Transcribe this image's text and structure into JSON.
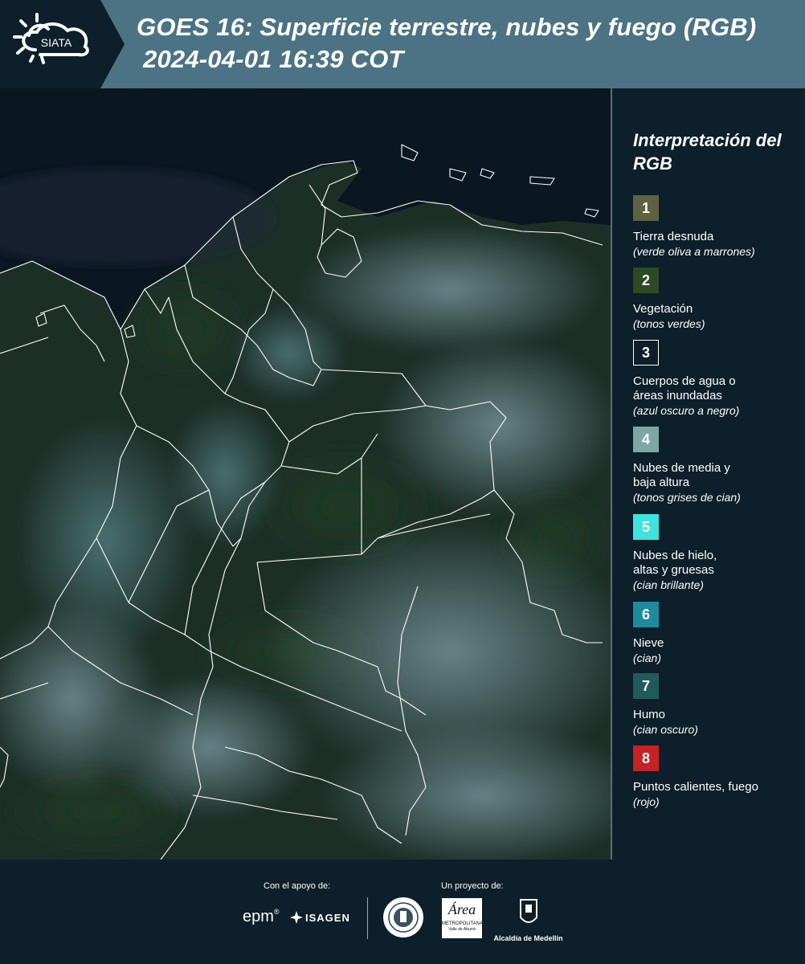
{
  "header": {
    "logo_text": "SIATA",
    "title_line1": "GOES 16: Superficie terrestre, nubes y fuego (RGB)",
    "title_line2": "2024-04-01 16:39 COT"
  },
  "legend": {
    "title": "Interpretación del RGB",
    "items": [
      {
        "number": "1",
        "label": "Tierra desnuda",
        "description": "(verde oliva a marrones)",
        "color": "#5e6142"
      },
      {
        "number": "2",
        "label": "Vegetación",
        "description": "(tonos verdes)",
        "color": "#2d4a22"
      },
      {
        "number": "3",
        "label": "Cuerpos de agua o áreas inundadas",
        "description": "(azul oscuro a negro)",
        "color": "#0c1f2a"
      },
      {
        "number": "4",
        "label": "Nubes de media y baja altura",
        "description": "(tonos grises de cian)",
        "color": "#7fa6a7"
      },
      {
        "number": "5",
        "label": "Nubes de hielo, altas y gruesas",
        "description": "(cian brillante)",
        "color": "#3ee3df"
      },
      {
        "number": "6",
        "label": "Nieve",
        "description": "(cian)",
        "color": "#1f8a9c"
      },
      {
        "number": "7",
        "label": "Humo",
        "description": "(cian oscuro)",
        "color": "#215a5d"
      },
      {
        "number": "8",
        "label": "Puntos calientes, fuego",
        "description": "(rojo)",
        "color": "#c42226"
      }
    ]
  },
  "footer": {
    "support_caption": "Con el apoyo de:",
    "project_caption": "Un proyecto de:",
    "logos": {
      "epm": "epm",
      "isagen": "ISAGEN",
      "area_metropolitana": "Área",
      "area_metropolitana_sub": "METROPOLITANA",
      "area_metropolitana_tagline": "Valle de Aburrá",
      "alcaldia": "Alcaldía de Medellín"
    }
  },
  "colors": {
    "header_bg": "#4b7384",
    "dark_bg": "#0c1f2a",
    "border_white": "#ffffff"
  }
}
